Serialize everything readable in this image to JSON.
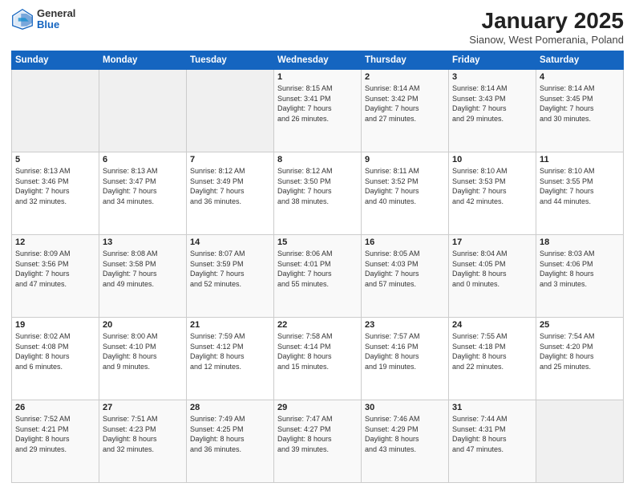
{
  "header": {
    "logo_general": "General",
    "logo_blue": "Blue",
    "month_title": "January 2025",
    "subtitle": "Sianow, West Pomerania, Poland"
  },
  "weekdays": [
    "Sunday",
    "Monday",
    "Tuesday",
    "Wednesday",
    "Thursday",
    "Friday",
    "Saturday"
  ],
  "weeks": [
    [
      {
        "day": "",
        "info": ""
      },
      {
        "day": "",
        "info": ""
      },
      {
        "day": "",
        "info": ""
      },
      {
        "day": "1",
        "info": "Sunrise: 8:15 AM\nSunset: 3:41 PM\nDaylight: 7 hours\nand 26 minutes."
      },
      {
        "day": "2",
        "info": "Sunrise: 8:14 AM\nSunset: 3:42 PM\nDaylight: 7 hours\nand 27 minutes."
      },
      {
        "day": "3",
        "info": "Sunrise: 8:14 AM\nSunset: 3:43 PM\nDaylight: 7 hours\nand 29 minutes."
      },
      {
        "day": "4",
        "info": "Sunrise: 8:14 AM\nSunset: 3:45 PM\nDaylight: 7 hours\nand 30 minutes."
      }
    ],
    [
      {
        "day": "5",
        "info": "Sunrise: 8:13 AM\nSunset: 3:46 PM\nDaylight: 7 hours\nand 32 minutes."
      },
      {
        "day": "6",
        "info": "Sunrise: 8:13 AM\nSunset: 3:47 PM\nDaylight: 7 hours\nand 34 minutes."
      },
      {
        "day": "7",
        "info": "Sunrise: 8:12 AM\nSunset: 3:49 PM\nDaylight: 7 hours\nand 36 minutes."
      },
      {
        "day": "8",
        "info": "Sunrise: 8:12 AM\nSunset: 3:50 PM\nDaylight: 7 hours\nand 38 minutes."
      },
      {
        "day": "9",
        "info": "Sunrise: 8:11 AM\nSunset: 3:52 PM\nDaylight: 7 hours\nand 40 minutes."
      },
      {
        "day": "10",
        "info": "Sunrise: 8:10 AM\nSunset: 3:53 PM\nDaylight: 7 hours\nand 42 minutes."
      },
      {
        "day": "11",
        "info": "Sunrise: 8:10 AM\nSunset: 3:55 PM\nDaylight: 7 hours\nand 44 minutes."
      }
    ],
    [
      {
        "day": "12",
        "info": "Sunrise: 8:09 AM\nSunset: 3:56 PM\nDaylight: 7 hours\nand 47 minutes."
      },
      {
        "day": "13",
        "info": "Sunrise: 8:08 AM\nSunset: 3:58 PM\nDaylight: 7 hours\nand 49 minutes."
      },
      {
        "day": "14",
        "info": "Sunrise: 8:07 AM\nSunset: 3:59 PM\nDaylight: 7 hours\nand 52 minutes."
      },
      {
        "day": "15",
        "info": "Sunrise: 8:06 AM\nSunset: 4:01 PM\nDaylight: 7 hours\nand 55 minutes."
      },
      {
        "day": "16",
        "info": "Sunrise: 8:05 AM\nSunset: 4:03 PM\nDaylight: 7 hours\nand 57 minutes."
      },
      {
        "day": "17",
        "info": "Sunrise: 8:04 AM\nSunset: 4:05 PM\nDaylight: 8 hours\nand 0 minutes."
      },
      {
        "day": "18",
        "info": "Sunrise: 8:03 AM\nSunset: 4:06 PM\nDaylight: 8 hours\nand 3 minutes."
      }
    ],
    [
      {
        "day": "19",
        "info": "Sunrise: 8:02 AM\nSunset: 4:08 PM\nDaylight: 8 hours\nand 6 minutes."
      },
      {
        "day": "20",
        "info": "Sunrise: 8:00 AM\nSunset: 4:10 PM\nDaylight: 8 hours\nand 9 minutes."
      },
      {
        "day": "21",
        "info": "Sunrise: 7:59 AM\nSunset: 4:12 PM\nDaylight: 8 hours\nand 12 minutes."
      },
      {
        "day": "22",
        "info": "Sunrise: 7:58 AM\nSunset: 4:14 PM\nDaylight: 8 hours\nand 15 minutes."
      },
      {
        "day": "23",
        "info": "Sunrise: 7:57 AM\nSunset: 4:16 PM\nDaylight: 8 hours\nand 19 minutes."
      },
      {
        "day": "24",
        "info": "Sunrise: 7:55 AM\nSunset: 4:18 PM\nDaylight: 8 hours\nand 22 minutes."
      },
      {
        "day": "25",
        "info": "Sunrise: 7:54 AM\nSunset: 4:20 PM\nDaylight: 8 hours\nand 25 minutes."
      }
    ],
    [
      {
        "day": "26",
        "info": "Sunrise: 7:52 AM\nSunset: 4:21 PM\nDaylight: 8 hours\nand 29 minutes."
      },
      {
        "day": "27",
        "info": "Sunrise: 7:51 AM\nSunset: 4:23 PM\nDaylight: 8 hours\nand 32 minutes."
      },
      {
        "day": "28",
        "info": "Sunrise: 7:49 AM\nSunset: 4:25 PM\nDaylight: 8 hours\nand 36 minutes."
      },
      {
        "day": "29",
        "info": "Sunrise: 7:47 AM\nSunset: 4:27 PM\nDaylight: 8 hours\nand 39 minutes."
      },
      {
        "day": "30",
        "info": "Sunrise: 7:46 AM\nSunset: 4:29 PM\nDaylight: 8 hours\nand 43 minutes."
      },
      {
        "day": "31",
        "info": "Sunrise: 7:44 AM\nSunset: 4:31 PM\nDaylight: 8 hours\nand 47 minutes."
      },
      {
        "day": "",
        "info": ""
      }
    ]
  ]
}
